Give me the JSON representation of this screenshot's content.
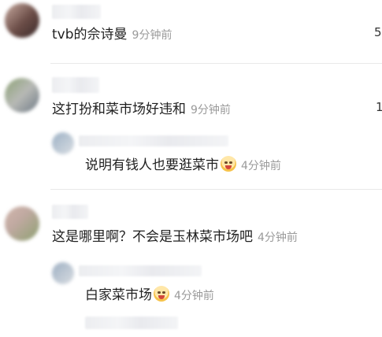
{
  "comments": [
    {
      "text": "tvb的佘诗曼",
      "time": "9分钟前",
      "likes": "5",
      "avatar_colors": [
        "#6f4f4a",
        "#c9a89d"
      ]
    },
    {
      "text": "这打扮和菜市场好违和",
      "time": "9分钟前",
      "likes": "1",
      "avatar_colors": [
        "#7a8e6a",
        "#b7b7b3"
      ],
      "reply": {
        "text": "说明有钱人也要逛菜市",
        "time": "4分钟前",
        "emoji": "laughing-crying-icon"
      }
    },
    {
      "text": "这是哪里啊？不会是玉林菜市场吧",
      "time": "4分钟前",
      "avatar_colors": [
        "#c7b2a8",
        "#8ea172"
      ],
      "reply": {
        "text": "白家菜市场",
        "time": "4分钟前",
        "emoji": "laughing-crying-icon"
      }
    }
  ]
}
